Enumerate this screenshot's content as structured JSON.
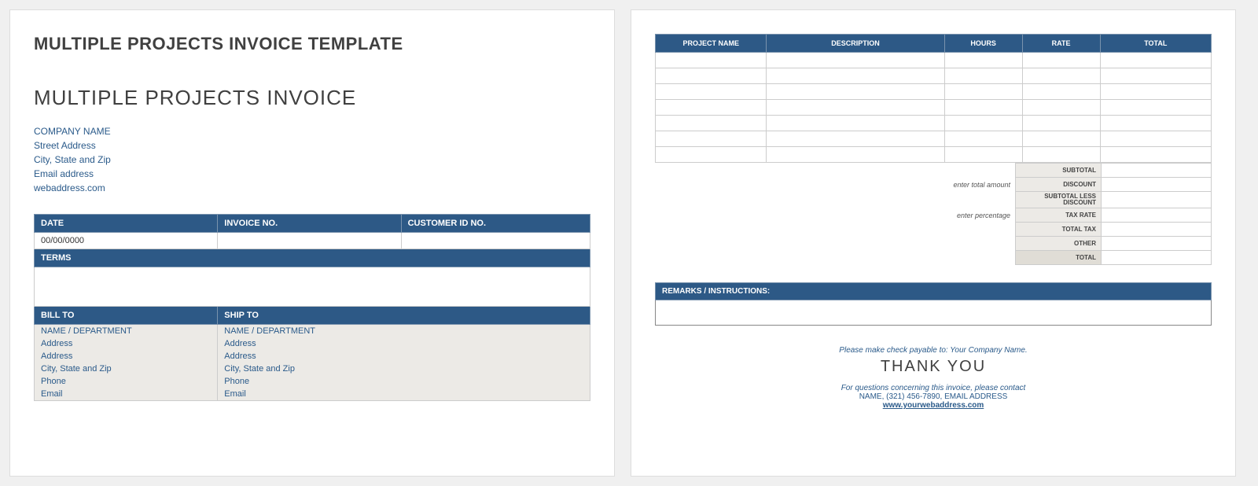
{
  "page1": {
    "template_title": "MULTIPLE PROJECTS INVOICE TEMPLATE",
    "invoice_title": "MULTIPLE PROJECTS INVOICE",
    "company": {
      "name": "COMPANY NAME",
      "street": "Street Address",
      "citystatezip": "City, State and Zip",
      "email": "Email address",
      "web": "webaddress.com"
    },
    "meta": {
      "date_label": "DATE",
      "invoice_no_label": "INVOICE NO.",
      "customer_id_label": "CUSTOMER ID NO.",
      "date_value": "00/00/0000",
      "invoice_no_value": "",
      "customer_id_value": ""
    },
    "terms_label": "TERMS",
    "billto_label": "BILL TO",
    "shipto_label": "SHIP TO",
    "address_fields": {
      "name_dept": "NAME / DEPARTMENT",
      "addr1": "Address",
      "addr2": "Address",
      "csz": "City, State and Zip",
      "phone": "Phone",
      "email": "Email"
    }
  },
  "page2": {
    "columns": {
      "project": "PROJECT NAME",
      "description": "DESCRIPTION",
      "hours": "HOURS",
      "rate": "RATE",
      "total": "TOTAL"
    },
    "rows": [
      "",
      "",
      "",
      "",
      "",
      "",
      ""
    ],
    "summary": {
      "note_amount": "enter total amount",
      "note_percentage": "enter percentage",
      "subtotal": "SUBTOTAL",
      "discount": "DISCOUNT",
      "subtotal_less": "SUBTOTAL LESS DISCOUNT",
      "tax_rate": "TAX RATE",
      "total_tax": "TOTAL TAX",
      "other": "OTHER",
      "total": "TOTAL"
    },
    "remarks_label": "REMARKS / INSTRUCTIONS:",
    "footer": {
      "payable": "Please make check payable to: Your Company Name.",
      "thank": "THANK YOU",
      "questions": "For questions concerning this invoice, please contact",
      "contact": "NAME, (321) 456-7890, EMAIL ADDRESS",
      "web": "www.yourwebaddress.com"
    }
  }
}
